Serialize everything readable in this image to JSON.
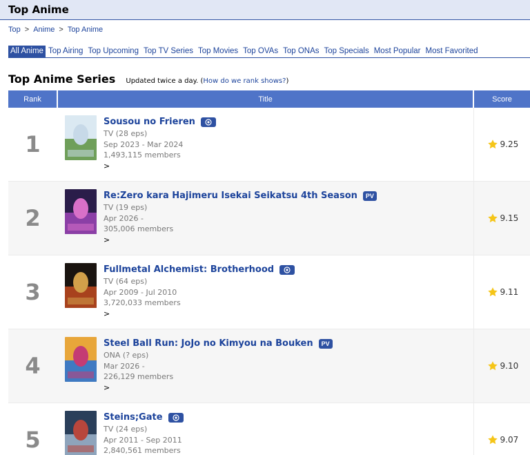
{
  "page": {
    "title": "Top Anime"
  },
  "breadcrumb": {
    "items": [
      "Top",
      "Anime",
      "Top Anime"
    ],
    "separator": ">"
  },
  "type_nav": {
    "items": [
      {
        "label": "All Anime",
        "active": true
      },
      {
        "label": "Top Airing",
        "active": false
      },
      {
        "label": "Top Upcoming",
        "active": false
      },
      {
        "label": "Top TV Series",
        "active": false
      },
      {
        "label": "Top Movies",
        "active": false
      },
      {
        "label": "Top OVAs",
        "active": false
      },
      {
        "label": "Top ONAs",
        "active": false
      },
      {
        "label": "Top Specials",
        "active": false
      },
      {
        "label": "Most Popular",
        "active": false
      },
      {
        "label": "Most Favorited",
        "active": false
      }
    ]
  },
  "series": {
    "heading": "Top Anime Series",
    "updated_text": "Updated twice a day.",
    "rank_link": "How do we rank shows?"
  },
  "table": {
    "headers": {
      "rank": "Rank",
      "title": "Title",
      "score": "Score"
    },
    "rows": [
      {
        "rank": "1",
        "title": "Sousou no Frieren",
        "badge": "play",
        "type": "TV (28 eps)",
        "dates": "Sep 2023 - Mar 2024",
        "members": "1,493,115 members",
        "more": ">",
        "score": "9.25",
        "thumb_colors": [
          "#dbe9f2",
          "#6f9f5a",
          "#c7d9e8"
        ]
      },
      {
        "rank": "2",
        "title": "Re:Zero kara Hajimeru Isekai Seikatsu 4th Season",
        "badge": "PV",
        "type": "TV (19 eps)",
        "dates": "Apr 2026 -",
        "members": "305,006 members",
        "more": ">",
        "score": "9.15",
        "thumb_colors": [
          "#2a1d4a",
          "#8b3fa6",
          "#d870c8"
        ]
      },
      {
        "rank": "3",
        "title": "Fullmetal Alchemist: Brotherhood",
        "badge": "play",
        "type": "TV (64 eps)",
        "dates": "Apr 2009 - Jul 2010",
        "members": "3,720,033 members",
        "more": ">",
        "score": "9.11",
        "thumb_colors": [
          "#1a1410",
          "#a8421d",
          "#d2a04a"
        ]
      },
      {
        "rank": "4",
        "title": "Steel Ball Run: JoJo no Kimyou na Bouken",
        "badge": "PV",
        "type": "ONA (? eps)",
        "dates": "Mar 2026 -",
        "members": "226,129 members",
        "more": ">",
        "score": "9.10",
        "thumb_colors": [
          "#e8a63a",
          "#3f7ac2",
          "#c43c74"
        ]
      },
      {
        "rank": "5",
        "title": "Steins;Gate",
        "badge": "play",
        "type": "TV (24 eps)",
        "dates": "Apr 2011 - Sep 2011",
        "members": "2,840,561 members",
        "more": ">",
        "score": "9.07",
        "thumb_colors": [
          "#2a3f5a",
          "#8ea4bc",
          "#b8463c"
        ]
      }
    ]
  },
  "colors": {
    "accent": "#2e51a2",
    "header_bg": "#4f74c8",
    "link": "#1c439b",
    "star": "#f5c518"
  }
}
